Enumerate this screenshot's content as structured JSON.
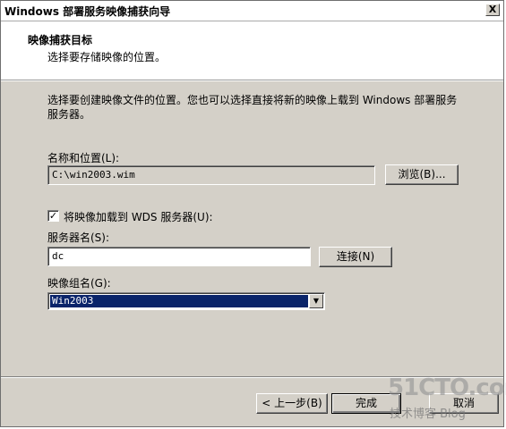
{
  "window": {
    "title": "Windows 部署服务映像捕获向导",
    "close_label": "X"
  },
  "header": {
    "title": "映像捕获目标",
    "subtitle": "选择要存储映像的位置。"
  },
  "description": "选择要创建映像文件的位置。您也可以选择直接将新的映像上载到 Windows 部署服务服务器。",
  "name_location": {
    "label": "名称和位置(L):",
    "value": "C:\\win2003.wim",
    "browse_label": "浏览(B)..."
  },
  "upload": {
    "checked": true,
    "check_mark": "✓",
    "label": "将映像加载到 WDS 服务器(U):"
  },
  "server": {
    "label": "服务器名(S):",
    "value": "dc",
    "connect_label": "连接(N)"
  },
  "image_group": {
    "label": "映像组名(G):",
    "selected": "Win2003",
    "arrow": "▼"
  },
  "footer": {
    "back_label": "< 上一步(B)",
    "finish_label": "完成",
    "cancel_label": "取消"
  },
  "watermark": {
    "main": "51CTO.com",
    "sub": "技术博客   Blog"
  }
}
